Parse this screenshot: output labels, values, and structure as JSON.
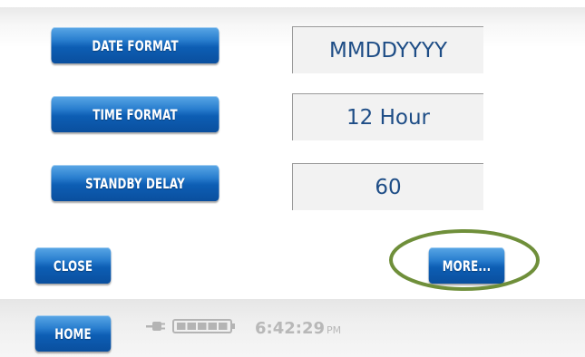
{
  "settings": [
    {
      "label": "DATE FORMAT",
      "value": "MMDDYYYY"
    },
    {
      "label": "TIME FORMAT",
      "value": "12 Hour"
    },
    {
      "label": "STANDBY DELAY",
      "value": "60"
    }
  ],
  "actions": {
    "close_label": "CLOSE",
    "more_label": "MORE..."
  },
  "footer": {
    "home_label": "HOME",
    "time": "6:42:29",
    "ampm": "PM",
    "power_icon": "plug-icon",
    "battery_icon": "battery-icon",
    "battery_level": 1.0
  },
  "colors": {
    "button_blue": "#0d5eb4",
    "value_text": "#1e4d86",
    "highlight_ring": "#6f8f3a"
  }
}
